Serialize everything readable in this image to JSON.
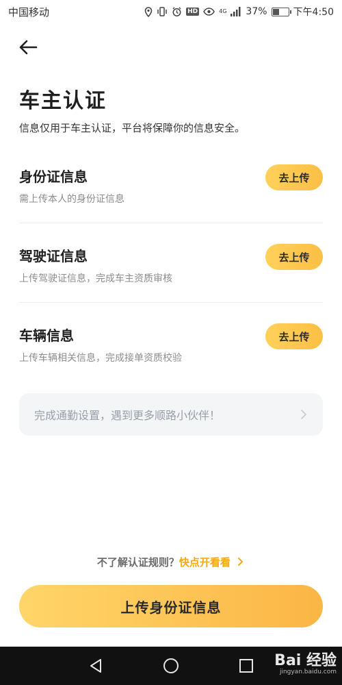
{
  "status_bar": {
    "carrier": "中国移动",
    "hd_badge": "HD",
    "network": "4G",
    "battery": "37%",
    "time": "下午4:50"
  },
  "page": {
    "title": "车主认证",
    "subtitle": "信息仅用于车主认证，平台将保障你的信息安全。"
  },
  "sections": [
    {
      "title": "身份证信息",
      "desc": "需上传本人的身份证信息",
      "button": "去上传"
    },
    {
      "title": "驾驶证信息",
      "desc": "上传驾驶证信息，完成车主资质审核",
      "button": "去上传"
    },
    {
      "title": "车辆信息",
      "desc": "上传车辆相关信息，完成接单资质校验",
      "button": "去上传"
    }
  ],
  "commute": {
    "text": "完成通勤设置，遇到更多顺路小伙伴！"
  },
  "rules": {
    "question": "不了解认证规则？",
    "link": "快点开看看"
  },
  "primary_button": "上传身份证信息",
  "watermark": {
    "main": "Bai 经验",
    "sub": "jingyan.baidu.com"
  },
  "colors": {
    "accent": "#fbbf45",
    "link": "#f0a91c"
  }
}
